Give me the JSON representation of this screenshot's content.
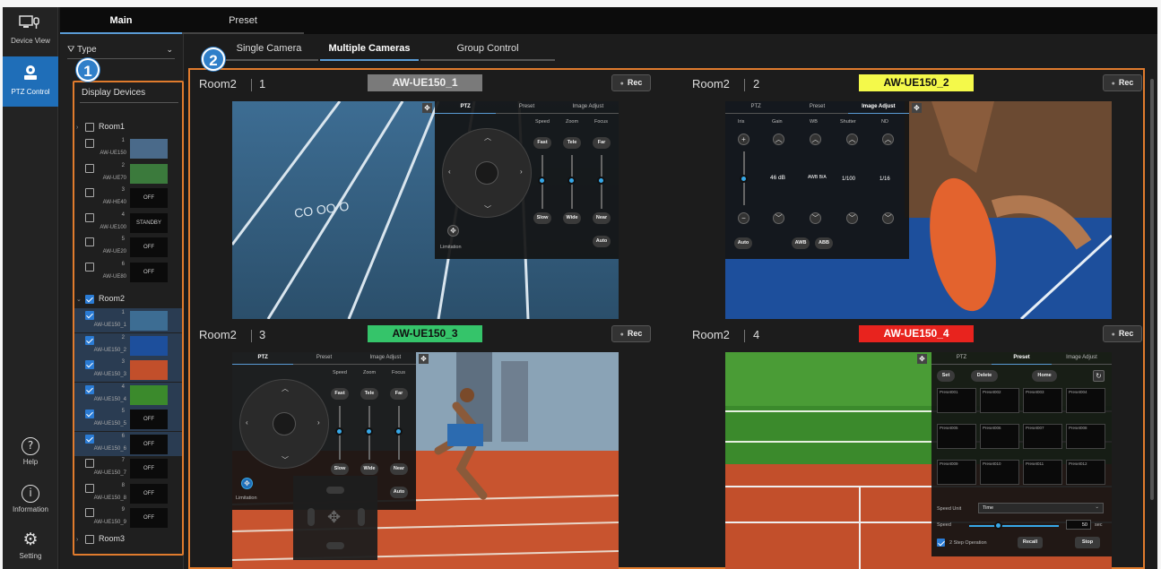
{
  "rail": {
    "device_view": "Device View",
    "ptz_control": "PTZ Control",
    "help": "Help",
    "information": "Information",
    "setting": "Setting"
  },
  "top_tabs": [
    "Main",
    "Preset"
  ],
  "filter": {
    "label": "Type"
  },
  "display_devices": {
    "title": "Display Devices",
    "rooms": [
      "Room1",
      "Room2",
      "Room3"
    ],
    "room1_devices": [
      {
        "num": "1",
        "name": "AW-UE150",
        "thumb": ""
      },
      {
        "num": "2",
        "name": "AW-UE70",
        "thumb": ""
      },
      {
        "num": "3",
        "name": "AW-HE40",
        "thumb": "OFF"
      },
      {
        "num": "4",
        "name": "AW-UE100",
        "thumb": "STANDBY"
      },
      {
        "num": "5",
        "name": "AW-UE20",
        "thumb": "OFF"
      },
      {
        "num": "6",
        "name": "AW-UE80",
        "thumb": "OFF"
      }
    ],
    "room2_devices": [
      {
        "num": "1",
        "name": "AW-UE150_1",
        "thumb": ""
      },
      {
        "num": "2",
        "name": "AW-UE150_2",
        "thumb": ""
      },
      {
        "num": "3",
        "name": "AW-UE150_3",
        "thumb": ""
      },
      {
        "num": "4",
        "name": "AW-UE150_4",
        "thumb": ""
      },
      {
        "num": "5",
        "name": "AW-UE150_5",
        "thumb": "OFF"
      },
      {
        "num": "6",
        "name": "AW-UE150_6",
        "thumb": "OFF"
      },
      {
        "num": "7",
        "name": "AW-UE150_7",
        "thumb": "OFF"
      },
      {
        "num": "8",
        "name": "AW-UE150_8",
        "thumb": "OFF"
      },
      {
        "num": "9",
        "name": "AW-UE150_9",
        "thumb": "OFF"
      }
    ]
  },
  "sub_tabs": [
    "Single Camera",
    "Multiple Cameras",
    "Group Control"
  ],
  "badges": [
    "1",
    "2"
  ],
  "panels": [
    {
      "room": "Room2",
      "num": "1",
      "name": "AW-UE150_1",
      "name_color": "#7a7a7a",
      "name_text_color": "#eeeeee",
      "rec": "Rec"
    },
    {
      "room": "Room2",
      "num": "2",
      "name": "AW-UE150_2",
      "name_color": "#f4f94a",
      "name_text_color": "#111111",
      "rec": "Rec"
    },
    {
      "room": "Room2",
      "num": "3",
      "name": "AW-UE150_3",
      "name_color": "#35c46a",
      "name_text_color": "#111111",
      "rec": "Rec"
    },
    {
      "room": "Room2",
      "num": "4",
      "name": "AW-UE150_4",
      "name_color": "#e8231e",
      "name_text_color": "#ffffff",
      "rec": "Rec"
    }
  ],
  "ptz_controls": {
    "tabs": [
      "PTZ",
      "Preset",
      "Image Adjust"
    ],
    "speed": "Speed",
    "zoom": "Zoom",
    "focus": "Focus",
    "fast": "Fast",
    "tele": "Tele",
    "far": "Far",
    "slow": "Slow",
    "wide": "Wide",
    "near": "Near",
    "auto": "Auto",
    "limitation": "Limitation"
  },
  "image_adjust": {
    "labels": [
      "Iris",
      "Gain",
      "WB",
      "Shutter",
      "ND"
    ],
    "values": [
      "",
      "46 dB",
      "AWB B/A",
      "1/100",
      "1/16"
    ],
    "auto": "Auto",
    "awb": "AWB",
    "abb": "ABB"
  },
  "preset_panel": {
    "set": "Set",
    "delete": "Delete",
    "home": "Home",
    "presets": [
      "Preset001",
      "Preset002",
      "Preset003",
      "Preset004",
      "Preset005",
      "Preset006",
      "Preset007",
      "Preset008",
      "Preset009",
      "Preset010",
      "Preset011",
      "Preset012"
    ],
    "speed_unit_label": "Speed Unit",
    "speed_unit_value": "Time",
    "speed_label": "Speed",
    "speed_value": "50",
    "speed_unit": "sec",
    "two_step": "2 Step Operation",
    "recall": "Recall",
    "stop": "Stop"
  },
  "colors": {
    "accent": "#e07b2d",
    "active_blue": "#1f6eb8",
    "slider_blue": "#37a8e8"
  }
}
